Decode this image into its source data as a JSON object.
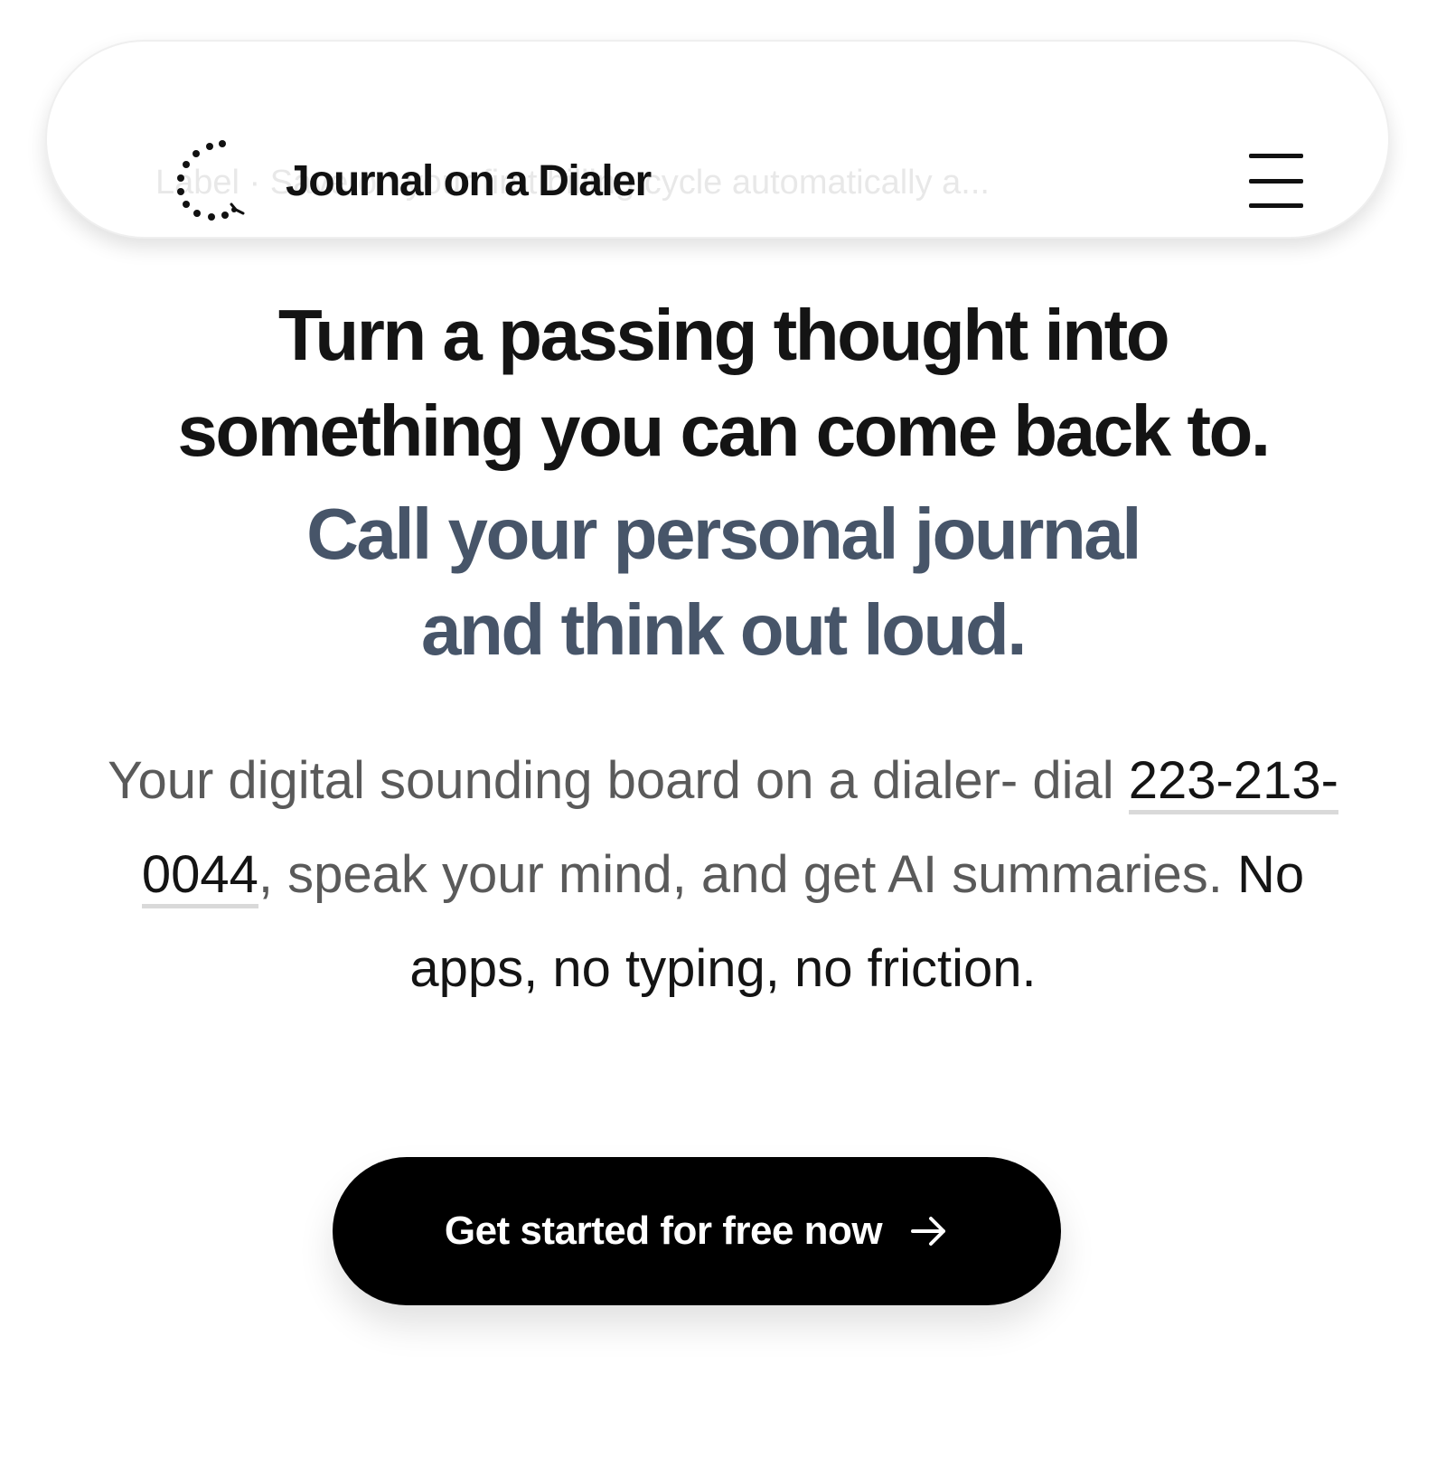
{
  "header": {
    "brand_name": "Journal on a Dialer",
    "ghost_banner": "Label  ·  Save on your first billing cycle automatically a...",
    "logo_icon": "dotted-circle-logo-icon",
    "menu_icon": "hamburger-menu-icon"
  },
  "hero": {
    "headline_line1": "Turn a passing thought into",
    "headline_line2": "something you can come back to.",
    "subheadline_line1": "Call your personal journal",
    "subheadline_line2": "and think out loud."
  },
  "description": {
    "prefix": "Your digital sounding board on a dialer- dial ",
    "phone": "223-213-0044",
    "middle": ", speak your mind, and get AI summaries. ",
    "emphasis": "No apps, no typing, no friction."
  },
  "cta": {
    "label": "Get started for free now",
    "icon": "arrow-right-icon"
  },
  "colors": {
    "text_primary": "#141414",
    "accent_slate": "#475569",
    "text_muted": "#5a5a5a",
    "cta_bg": "#000000"
  }
}
